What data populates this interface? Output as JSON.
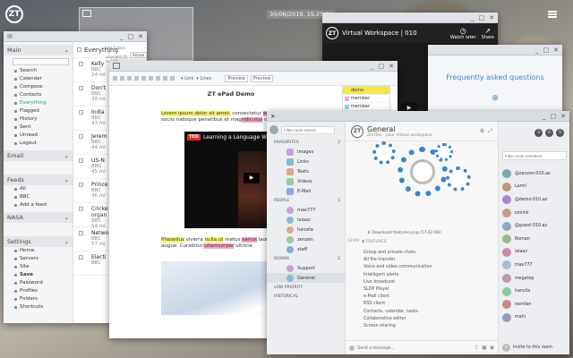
{
  "desktop": {
    "clock": "30/06/2019, 15:20:38"
  },
  "mail": {
    "menu": [
      {
        "name": "Main",
        "items": [
          "Search",
          "Calendar",
          "Compose",
          "Contacts",
          "Everything",
          "Flagged",
          "History",
          "Sent",
          "Unread",
          "Logout"
        ]
      },
      {
        "name": "Email",
        "items": []
      },
      {
        "name": "Feeds",
        "items": [
          "All",
          "BBC",
          "Add a feed"
        ]
      },
      {
        "name": "NASA",
        "items": []
      },
      {
        "name": "Settings",
        "items": [
          "Home",
          "Servers",
          "Site",
          "Save",
          "Password",
          "Profiles",
          "Folders",
          "Shortcuts"
        ]
      }
    ],
    "list_title": "Everything",
    "list_sub": "last 7 days - 2 source(s) [0 to 100]",
    "sort": "Arrival",
    "rows": [
      {
        "title": "Kelly",
        "src": "BBC",
        "time": "24 mi"
      },
      {
        "title": "Don't",
        "src": "BBC",
        "time": "39 mi"
      },
      {
        "title": "India",
        "src": "BBC",
        "time": "43 mi"
      },
      {
        "title": "Jerem",
        "src": "BBC",
        "time": "44 mi"
      },
      {
        "title": "US-N",
        "src": "BBC",
        "time": "45 mi"
      },
      {
        "title": "Prince",
        "src": "BBC",
        "time": "46 mi"
      },
      {
        "title": "Cricke",
        "title2": "organ",
        "src": "BBC",
        "time": "54 mi"
      },
      {
        "title": "Netwo",
        "src": "BBC",
        "time": "57 mi"
      },
      {
        "title": "Electi",
        "src": "BBC",
        "time": ""
      }
    ]
  },
  "video_win": {
    "title": "Virtual Workspace | 010",
    "watch_later": "Watch later",
    "share": "Share"
  },
  "faq": {
    "title": "Frequently asked questions"
  },
  "editor": {
    "doc_title": "ZT ePad Demo",
    "p1": [
      {
        "t": "Lorem ipsum dolor sit amet,",
        "h": "y"
      },
      {
        "t": " consectetur ",
        "h": ""
      },
      {
        "t": "adipiscing",
        "h": "p"
      },
      {
        "t": "Aenean massa. ",
        "h": ""
      },
      {
        "t": "Cum sociis natoque penatibus et mag",
        "h": ""
      },
      {
        "t": "ridiculus",
        "h": "p"
      },
      {
        "t": " mus.",
        "h": ""
      }
    ],
    "video_caption": "Learning a Language Will Changeⓘ",
    "p2": [
      {
        "t": "Phasellus",
        "h": "y"
      },
      {
        "t": " viverra ",
        "h": ""
      },
      {
        "t": "nulla ut",
        "h": "y"
      },
      {
        "t": " metus ",
        "h": ""
      },
      {
        "t": "varius",
        "h": "p"
      },
      {
        "t": " laoreet. ",
        "h": ""
      },
      {
        "t": "Quisq",
        "h": "y"
      },
      {
        "t": "ultricies nisi vel augue. ",
        "h": ""
      },
      {
        "t": "Curabitur",
        "h": ""
      },
      {
        "t": " ullamcorper",
        "h": "p"
      },
      {
        "t": " ultricie",
        "h": ""
      }
    ],
    "authors": [
      {
        "name": "demo",
        "color": "#f7e84a"
      },
      {
        "name": "member",
        "color": "#f3a3c8"
      },
      {
        "name": "member",
        "color": "#8fd1f0"
      }
    ],
    "toolbar": [
      "Preview",
      "Preview",
      "▾ Link",
      "▾ Lines"
    ]
  },
  "chat": {
    "search_placeholder": "Filter room names",
    "sections": [
      {
        "name": "FAVOURITES",
        "count": "2",
        "items": [
          "Images",
          "Links",
          "Texts",
          "Videos",
          "E-Mail"
        ]
      },
      {
        "name": "PEOPLE",
        "count": "5",
        "items": [
          "max777",
          "lalaaz",
          "hanzila",
          "zenzen",
          "staff"
        ]
      },
      {
        "name": "ROOMS",
        "count": "2",
        "items": [
          "Support",
          "General"
        ]
      },
      {
        "name": "LOW PRIORITY",
        "count": "",
        "items": []
      },
      {
        "name": "HISTORICAL",
        "count": "",
        "items": []
      }
    ],
    "room": "General",
    "room_sub": "ZenTen - your Virtual workspace",
    "download": "Download features.png (57.42 KB)",
    "feature_head": "FEATURES",
    "features": [
      "Group and private chats",
      "All file-transfer",
      "Voice and video communication",
      "Intelligent alerts",
      "Live broadcast",
      "SLDP Player",
      "e-Mail client",
      "RSS client",
      "Contacts, calendar, tasks",
      "Collaborative editor",
      "Screen sharing"
    ],
    "time": "12:09",
    "message_placeholder": "Send a message...",
    "badges": [
      "3",
      "0",
      "5"
    ],
    "members_placeholder": "Filter room members",
    "members": [
      "@zenzen:010.az",
      "Lamil",
      "@demo:010.az",
      "smlink",
      "@guest:010.az",
      "Roman",
      "lalaaz",
      "max777",
      "megatop",
      "hanzila",
      "nemfan",
      "mahi"
    ],
    "invite": "Invite to this room"
  }
}
